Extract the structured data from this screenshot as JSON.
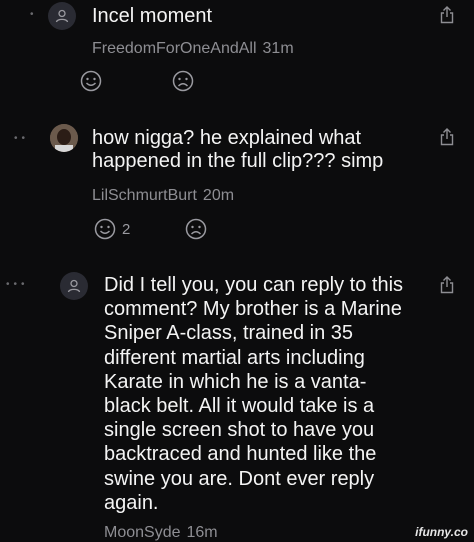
{
  "comments": [
    {
      "text": "Incel moment",
      "author": "FreedomForOneAndAll",
      "time": "31m",
      "upvotes": "",
      "icons": {
        "avatar": "user-icon",
        "share": "share-icon",
        "upvote": "smiley-icon",
        "downvote": "frown-icon"
      }
    },
    {
      "text": "how nigga? he explained what happened in the full clip??? simp",
      "author": "LilSchmurtBurt",
      "time": "20m",
      "upvotes": "2",
      "icons": {
        "avatar": "profile-photo",
        "share": "share-icon",
        "upvote": "smiley-icon",
        "downvote": "frown-icon"
      }
    },
    {
      "text": "Did I tell you, you can reply to this comment? My brother is a Marine Sniper A-class, trained in 35 different martial arts including Karate in which he is a vanta-black belt. All it would take is a single screen shot to have you backtraced and hunted like the swine you are. Dont ever reply again.",
      "author": "MoonSyde",
      "time": "16m",
      "icons": {
        "avatar": "user-icon",
        "share": "share-icon"
      }
    }
  ],
  "watermark": "ifunny.co",
  "colors": {
    "background": "#0c0c0d",
    "text": "#f4f4f4",
    "meta": "#8e8e93",
    "icon": "#9a9aa0"
  }
}
